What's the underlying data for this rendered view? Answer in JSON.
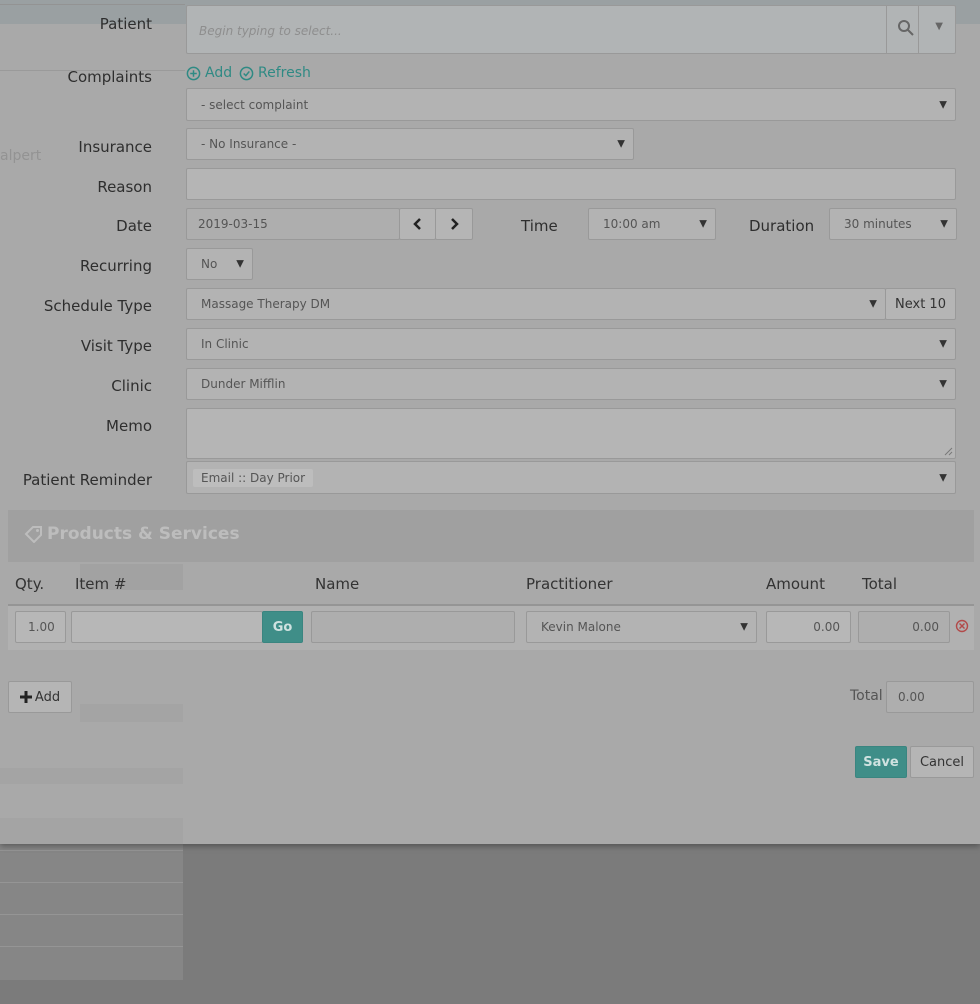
{
  "labels": {
    "patient": "Patient",
    "complaints": "Complaints",
    "insurance": "Insurance",
    "reason": "Reason",
    "date": "Date",
    "time": "Time",
    "duration": "Duration",
    "recurring": "Recurring",
    "schedule_type": "Schedule Type",
    "visit_type": "Visit Type",
    "clinic": "Clinic",
    "memo": "Memo",
    "patient_reminder": "Patient Reminder"
  },
  "patient": {
    "placeholder": "Begin typing to select..."
  },
  "complaints": {
    "add": "Add",
    "refresh": "Refresh",
    "selected": "- select complaint"
  },
  "insurance": {
    "selected": "- No Insurance -"
  },
  "reason": {
    "value": ""
  },
  "date": {
    "value": "2019-03-15"
  },
  "time": {
    "selected": "10:00 am"
  },
  "duration": {
    "selected": "30 minutes"
  },
  "recurring": {
    "selected": "No"
  },
  "schedule_type": {
    "selected": "Massage Therapy DM",
    "next_label": "Next 10"
  },
  "visit_type": {
    "selected": "In Clinic"
  },
  "clinic": {
    "selected": "Dunder Mifflin"
  },
  "memo": {
    "value": ""
  },
  "patient_reminder": {
    "selected": "Email :: Day Prior"
  },
  "background": {
    "fragment_text": "alpert"
  },
  "products": {
    "title": "Products & Services",
    "columns": [
      "Qty.",
      "Item #",
      "Name",
      "Practitioner",
      "Amount",
      "Total"
    ],
    "row": {
      "qty": "1.00",
      "item": "",
      "go_label": "Go",
      "name": "",
      "practitioner": "Kevin Malone",
      "amount": "0.00",
      "total": "0.00"
    },
    "add_label": "Add",
    "total_label": "Total",
    "total_value": "0.00"
  },
  "actions": {
    "save": "Save",
    "cancel": "Cancel"
  },
  "colors": {
    "accent": "#2f8a84",
    "overlay": "#7b7b7b"
  }
}
